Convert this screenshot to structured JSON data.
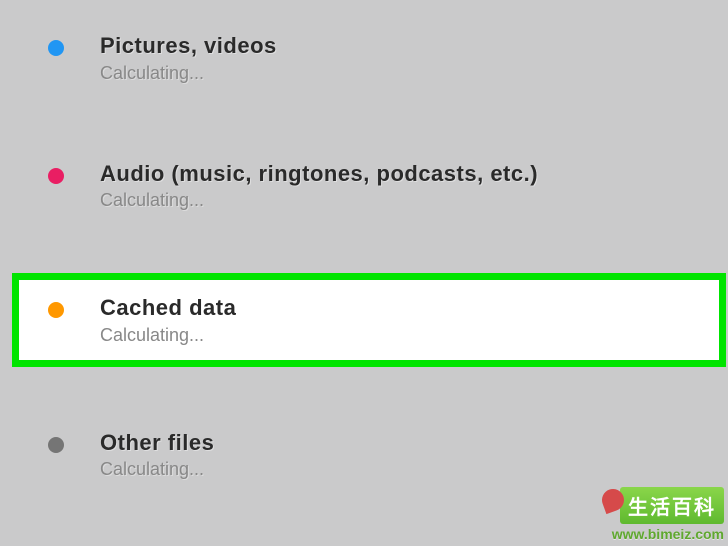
{
  "storage": {
    "items": [
      {
        "title": "Pictures, videos",
        "status": "Calculating...",
        "bullet_color": "#2196f3",
        "highlighted": false
      },
      {
        "title": "Audio (music, ringtones, podcasts, etc.)",
        "status": "Calculating...",
        "bullet_color": "#e91e63",
        "highlighted": false
      },
      {
        "title": "Cached data",
        "status": "Calculating...",
        "bullet_color": "#ff9800",
        "highlighted": true
      },
      {
        "title": "Other files",
        "status": "Calculating...",
        "bullet_color": "#757575",
        "highlighted": false
      }
    ]
  },
  "watermark": {
    "logo_text": "生活百科",
    "url": "www.bimeiz.com"
  },
  "colors": {
    "highlight_border": "#00e400",
    "background": "#cacacb"
  }
}
